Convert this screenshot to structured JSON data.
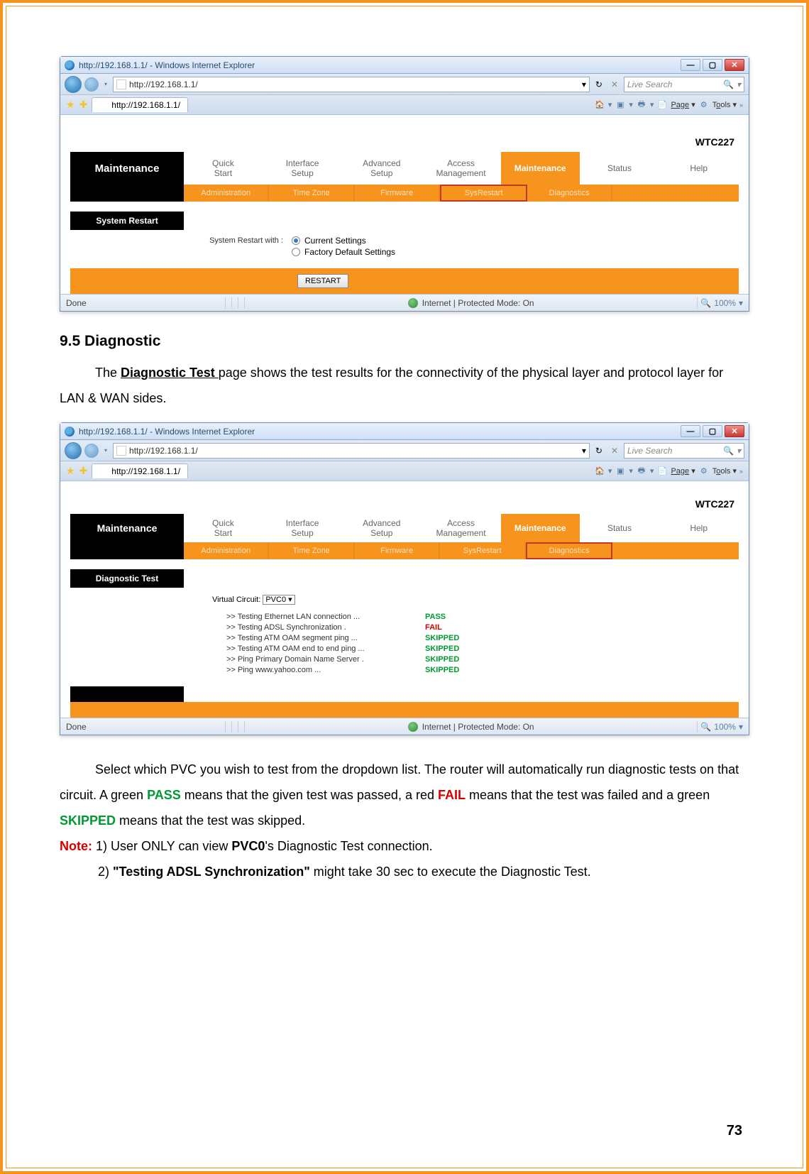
{
  "page_number": "73",
  "doc": {
    "heading": "9.5 Diagnostic",
    "p1_a": "The ",
    "p1_b": "Diagnostic Test ",
    "p1_c": "page shows the test results for the connectivity of the physical layer and protocol layer for LAN & WAN sides.",
    "p2_a": "Select which PVC you wish to test from the dropdown list. The router will automatically run diagnostic tests on that circuit. A green ",
    "p2_pass": "PASS",
    "p2_b": " means that the given test was passed, a red ",
    "p2_fail": "FAIL",
    "p2_c": " means that the test was failed and a green ",
    "p2_skipped": "SKIPPED",
    "p2_d": " means that the test was skipped.",
    "note_label": "Note: ",
    "note1_a": "1) User ONLY can view ",
    "note1_b": "PVC0",
    "note1_c": "'s Diagnostic Test connection.",
    "note2_a": "2) ",
    "note2_b": "\"Testing ADSL Synchronization\"",
    "note2_c": " might take 30 sec to execute the Diagnostic Test."
  },
  "browser": {
    "title": "http://192.168.1.1/ - Windows Internet Explorer",
    "url": "http://192.168.1.1/",
    "tab_label": "http://192.168.1.1/",
    "search_placeholder": "Live Search",
    "page_menu": "Page",
    "tools_menu": "Tools",
    "status_done": "Done",
    "status_mode": "Internet | Protected Mode: On",
    "zoom": "100%"
  },
  "router": {
    "model": "WTC227",
    "nav_label": "Maintenance",
    "main_tabs": [
      {
        "l1": "Quick",
        "l2": "Start"
      },
      {
        "l1": "Interface",
        "l2": "Setup"
      },
      {
        "l1": "Advanced",
        "l2": "Setup"
      },
      {
        "l1": "Access",
        "l2": "Management"
      },
      {
        "l1": "Maintenance",
        "l2": ""
      },
      {
        "l1": "Status",
        "l2": ""
      },
      {
        "l1": "Help",
        "l2": ""
      }
    ],
    "sub_tabs": [
      "Administration",
      "Time Zone",
      "Firmware",
      "SysRestart",
      "Diagnostics"
    ]
  },
  "sysrestart": {
    "section": "System Restart",
    "label": "System Restart with :",
    "opt1": "Current Settings",
    "opt2": "Factory Default Settings",
    "button": "RESTART"
  },
  "diag": {
    "section": "Diagnostic Test",
    "vc_label": "Virtual Circuit:",
    "vc_value": "PVC0",
    "tests": [
      {
        "name": ">> Testing Ethernet LAN connection ...",
        "result": "PASS",
        "cls": "pass"
      },
      {
        "name": ">> Testing ADSL Synchronization .",
        "result": "FAIL",
        "cls": "fail"
      },
      {
        "name": ">> Testing ATM OAM segment ping ...",
        "result": "SKIPPED",
        "cls": "skipped"
      },
      {
        "name": ">> Testing ATM OAM end to end ping ...",
        "result": "SKIPPED",
        "cls": "skipped"
      },
      {
        "name": ">> Ping Primary Domain Name Server .",
        "result": "SKIPPED",
        "cls": "skipped"
      },
      {
        "name": ">> Ping www.yahoo.com ...",
        "result": "SKIPPED",
        "cls": "skipped"
      }
    ]
  }
}
